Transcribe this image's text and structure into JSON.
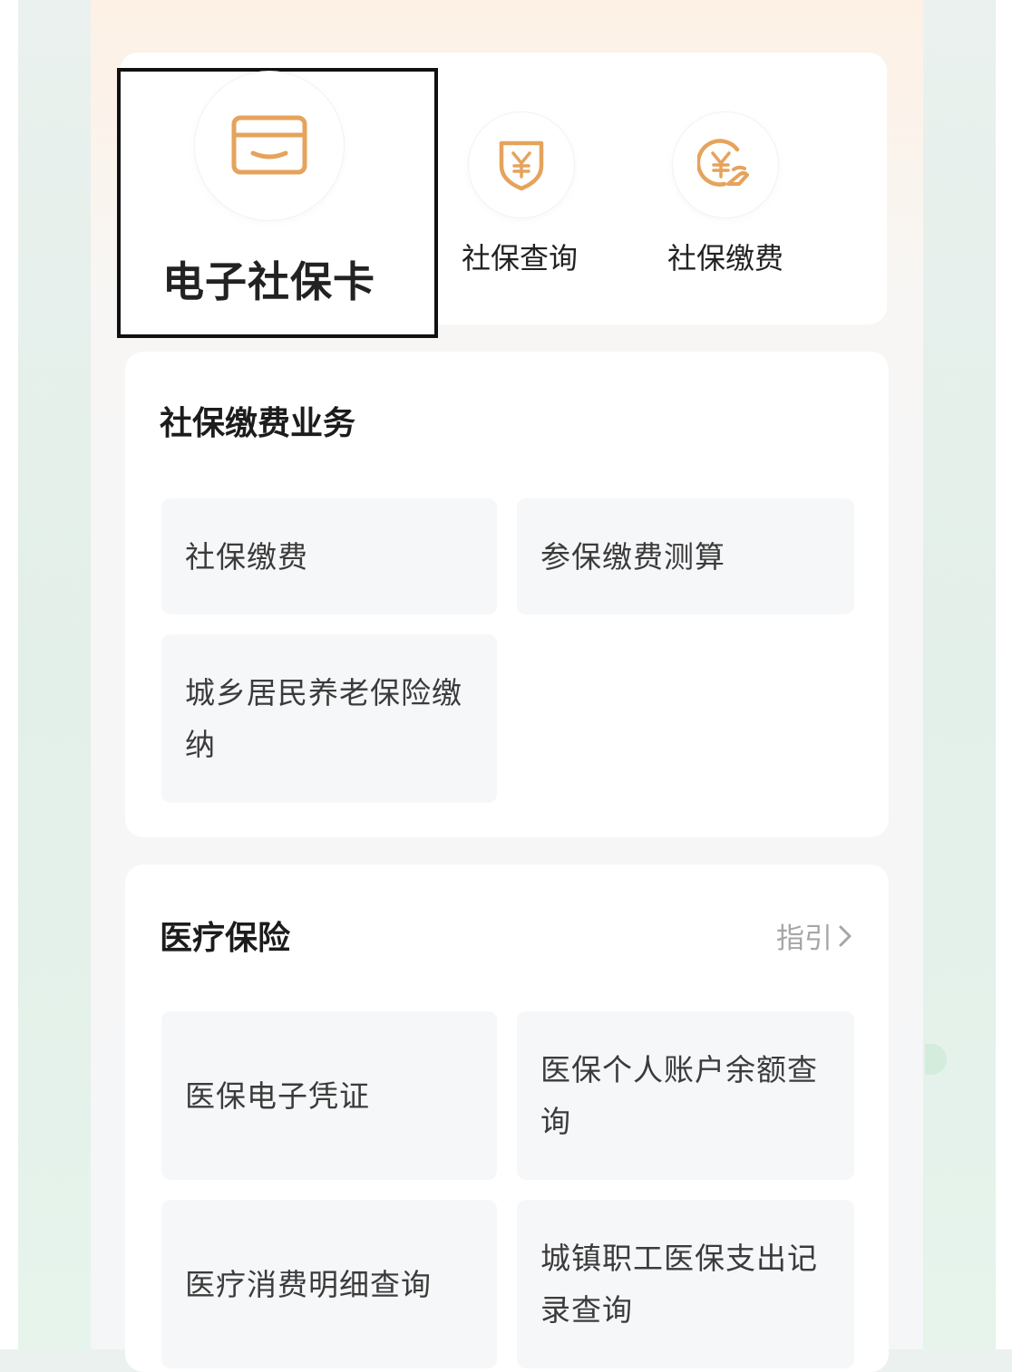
{
  "quick_access": {
    "items": [
      {
        "label": "电子社保卡",
        "icon": "card-icon"
      },
      {
        "label": "社保查询",
        "icon": "shield-yen-icon"
      },
      {
        "label": "社保缴费",
        "icon": "yen-hand-icon"
      }
    ]
  },
  "pay_section": {
    "title": "社保缴费业务",
    "tiles": [
      "社保缴费",
      "参保缴费测算",
      "城乡居民养老保险缴纳"
    ]
  },
  "medical_section": {
    "title": "医疗保险",
    "guide_label": "指引",
    "tiles": [
      "医保电子凭证",
      "医保个人账户余额查询",
      "医疗消费明细查询",
      "城镇职工医保支出记录查询"
    ]
  },
  "colors": {
    "accent": "#e5a35c",
    "text_primary": "#222222",
    "tile_bg": "#f6f7f9"
  }
}
